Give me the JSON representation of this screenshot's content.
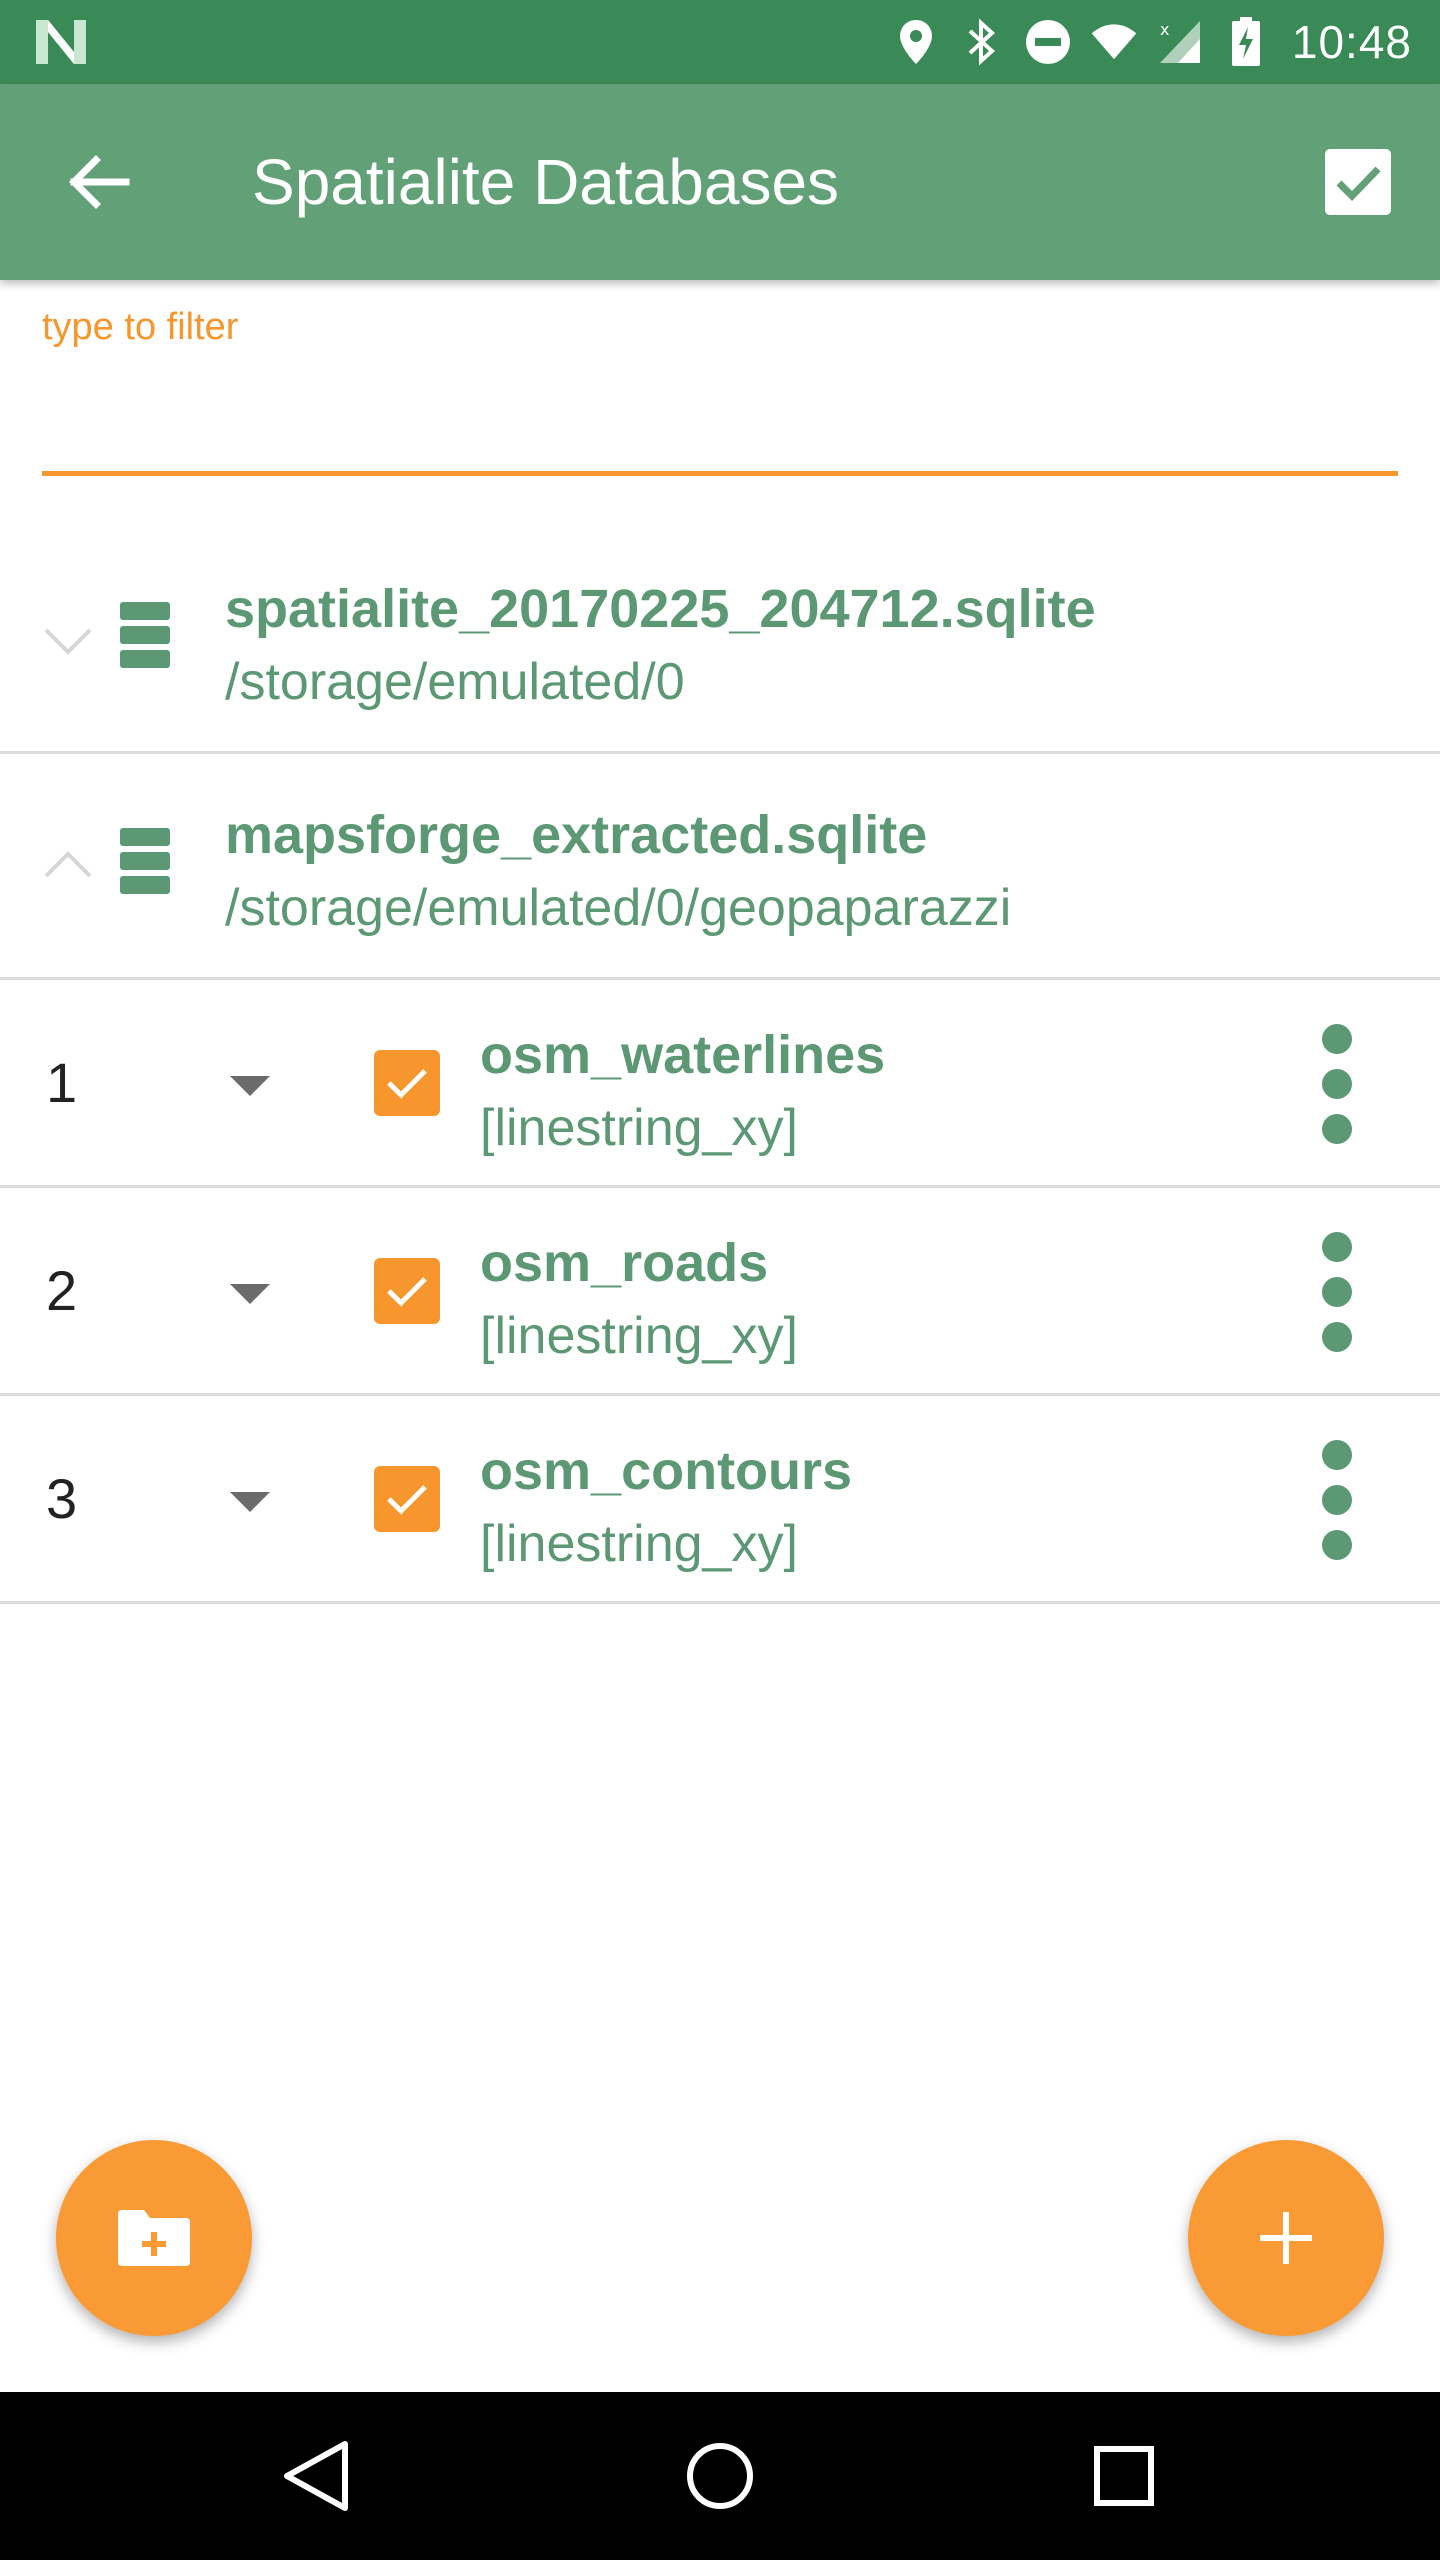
{
  "status_bar": {
    "time": "10:48",
    "icons": [
      "n-logo-icon",
      "location-icon",
      "bluetooth-icon",
      "do-not-disturb-icon",
      "wifi-icon",
      "signal-icon",
      "battery-charging-icon"
    ]
  },
  "app_bar": {
    "title": "Spatialite Databases",
    "back_icon": "arrow-back-icon",
    "confirm_icon": "check-box-icon"
  },
  "filter": {
    "label": "type to filter",
    "value": "",
    "placeholder": ""
  },
  "databases": [
    {
      "name": "spatialite_20170225_204712.sqlite",
      "path": "/storage/emulated/0",
      "expanded": false
    },
    {
      "name": "mapsforge_extracted.sqlite",
      "path": "/storage/emulated/0/geopaparazzi",
      "expanded": true
    }
  ],
  "layers": [
    {
      "index": "1",
      "name": "osm_waterlines",
      "type": "[linestring_xy]",
      "checked": true
    },
    {
      "index": "2",
      "name": "osm_roads",
      "type": "[linestring_xy]",
      "checked": true
    },
    {
      "index": "3",
      "name": "osm_contours",
      "type": "[linestring_xy]",
      "checked": true
    }
  ],
  "fabs": {
    "left_icon": "folder-add-icon",
    "right_icon": "add-icon"
  },
  "nav_bar": [
    "nav-back-icon",
    "nav-home-icon",
    "nav-recents-icon"
  ],
  "colors": {
    "status_bar": "#3a8a57",
    "app_bar": "#62a177",
    "accent": "#f6962d",
    "text_green": "#5b9873"
  }
}
